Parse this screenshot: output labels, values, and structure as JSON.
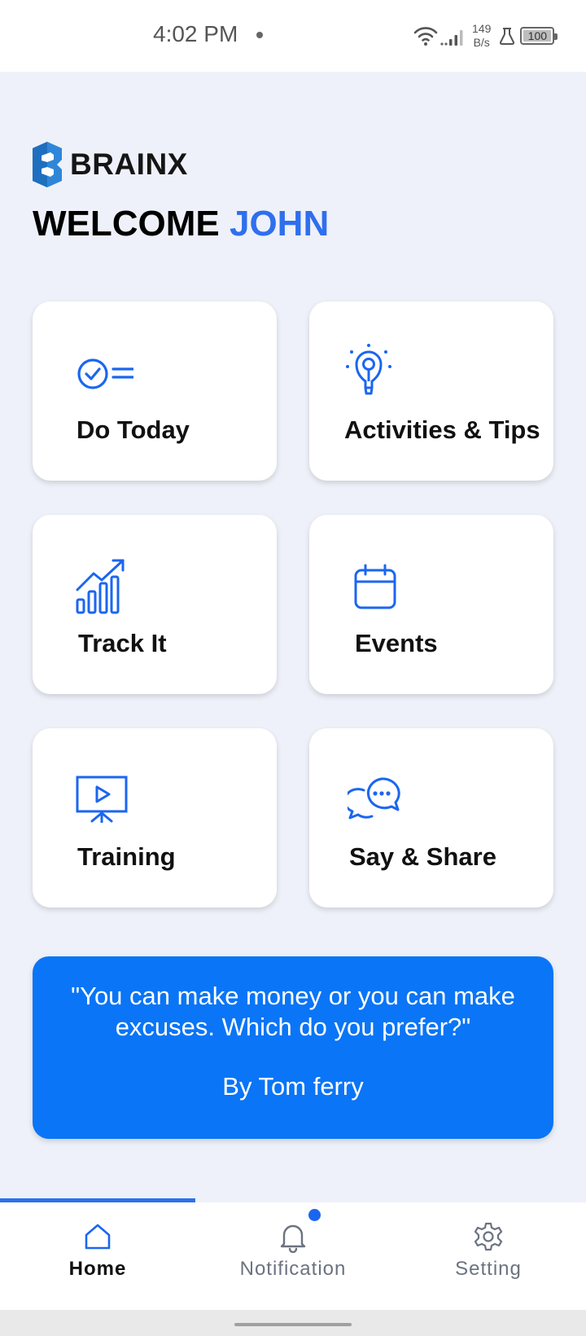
{
  "status_bar": {
    "time": "4:02 PM",
    "net_speed_value": "149",
    "net_speed_unit": "B/s",
    "battery": "100"
  },
  "brand": {
    "name": "BRAINX",
    "logo_color": "#2f86d8"
  },
  "header": {
    "welcome_prefix": "WELCOME ",
    "user_name": "JOHN"
  },
  "tiles": [
    {
      "label": "Do Today",
      "icon": "checklist-icon"
    },
    {
      "label": "Activities & Tips",
      "icon": "lightbulb-icon"
    },
    {
      "label": "Track It",
      "icon": "growth-chart-icon"
    },
    {
      "label": "Events",
      "icon": "calendar-icon"
    },
    {
      "label": "Training",
      "icon": "presentation-play-icon"
    },
    {
      "label": "Say & Share",
      "icon": "chat-bubbles-icon"
    }
  ],
  "quote": {
    "text": "\"You can make money or you can make excuses. Which do you prefer?\"",
    "author": "By Tom ferry"
  },
  "bottom_nav": {
    "items": [
      {
        "label": "Home",
        "icon": "home-icon",
        "active": true
      },
      {
        "label": "Notification",
        "icon": "bell-icon",
        "active": false,
        "badge": true
      },
      {
        "label": "Setting",
        "icon": "gear-icon",
        "active": false
      }
    ]
  },
  "colors": {
    "accent": "#2f6fee",
    "quote_background": "#0a75f6",
    "page_background": "#eef1f9",
    "card_background": "#ffffff"
  }
}
